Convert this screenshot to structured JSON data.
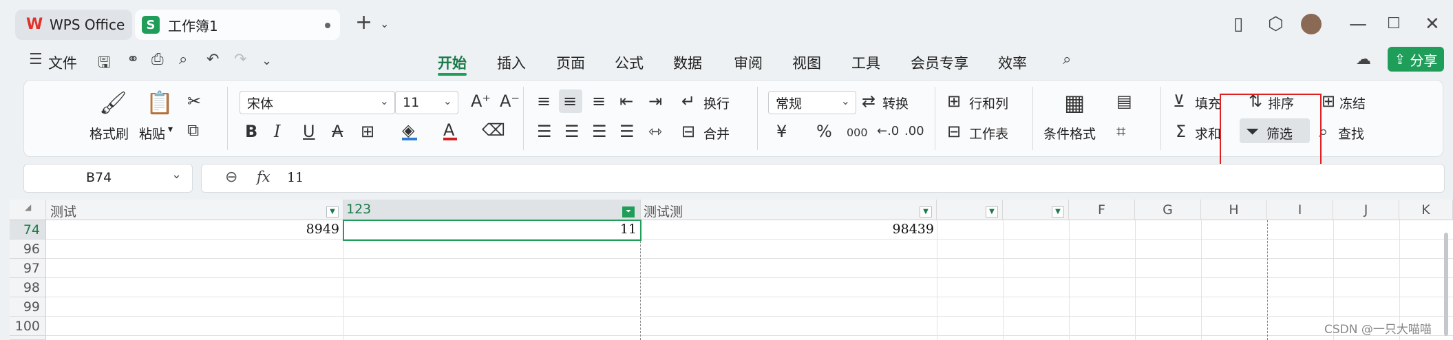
{
  "tabs": {
    "app_tab": "WPS Office",
    "doc_tab": "工作簿1",
    "new_tab": "+"
  },
  "menu": {
    "file": "文件",
    "items": [
      "开始",
      "插入",
      "页面",
      "公式",
      "数据",
      "审阅",
      "视图",
      "工具",
      "会员专享",
      "效率"
    ],
    "share": "分享"
  },
  "ribbon": {
    "format_painter": "格式刷",
    "paste": "粘贴",
    "font_name": "宋体",
    "font_size": "11",
    "wrap": "换行",
    "merge": "合并",
    "number_format": "常规",
    "convert": "转换",
    "rows_cols": "行和列",
    "worksheet": "工作表",
    "conditional_format": "条件格式",
    "fill": "填充",
    "sort": "排序",
    "freeze": "冻结",
    "sum": "求和",
    "filter": "筛选",
    "find": "查找",
    "currency_symbol": "¥",
    "percent_symbol": "%",
    "thousands_symbol": "000"
  },
  "formula_bar": {
    "cell_ref": "B74",
    "fx": "fx",
    "value": "11"
  },
  "sheet": {
    "columns": [
      "测试",
      "123",
      "测试测",
      "",
      "",
      "F",
      "G",
      "H",
      "I",
      "J",
      "K"
    ],
    "rows": [
      {
        "num": "74",
        "a": "8949",
        "b": "11",
        "c": "98439"
      },
      {
        "num": "96"
      },
      {
        "num": "97"
      },
      {
        "num": "98"
      },
      {
        "num": "99"
      },
      {
        "num": "100"
      }
    ]
  },
  "watermark": "CSDN @一只大喵喵",
  "colors": {
    "accent": "#1f9e5a",
    "highlight_box": "#e02020"
  }
}
